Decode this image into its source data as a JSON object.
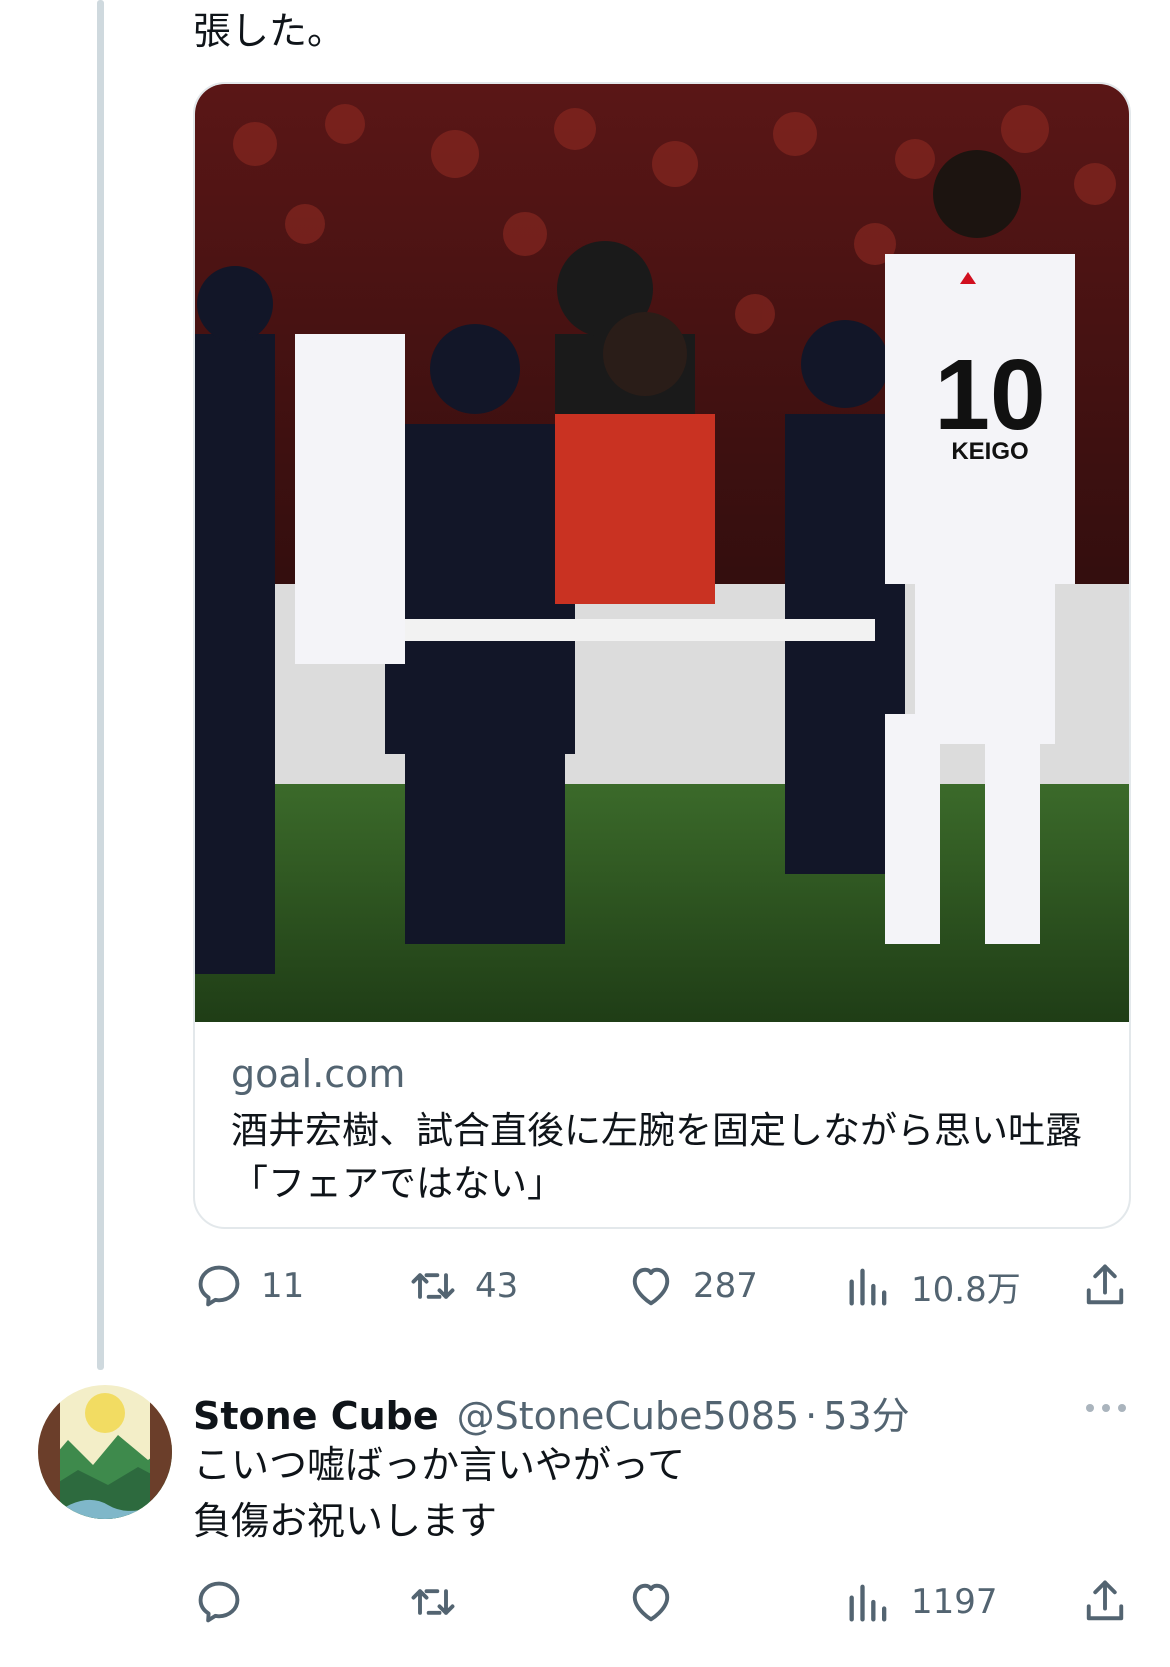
{
  "parent_tweet": {
    "text_tail": "張した。",
    "link_card": {
      "domain": "goal.com",
      "title": "酒井宏樹、試合直後に左腕を固定しながら思い吐露「フェアではない」"
    },
    "actions": {
      "replies": "11",
      "retweets": "43",
      "likes": "287",
      "views": "10.8万"
    }
  },
  "reply_tweet": {
    "display_name": "Stone Cube",
    "handle": "@StoneCube5085",
    "separator": "·",
    "time": "53分",
    "lines": [
      "こいつ嘘ばっか言いやがって",
      "負傷お祝いします"
    ],
    "actions": {
      "views": "1197"
    }
  },
  "colors": {
    "text": "#0f1419",
    "secondary": "#536471",
    "border": "#e3e8eb",
    "thread_line": "#cfd9de"
  }
}
